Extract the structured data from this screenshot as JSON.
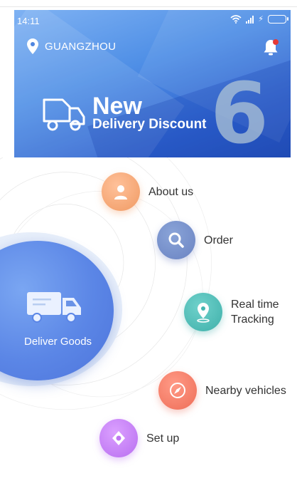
{
  "status_bar": {
    "time": "14:11"
  },
  "location": {
    "city": "GUANGZHOU"
  },
  "banner": {
    "title_line1": "New",
    "title_line2": "Delivery Discount",
    "number": "6"
  },
  "center": {
    "label": "Deliver Goods"
  },
  "menu": [
    {
      "label": "About us",
      "icon": "person-icon",
      "color": "#f3a06b"
    },
    {
      "label": "Order",
      "icon": "search-icon",
      "color": "#7189c8"
    },
    {
      "label_line1": "Real time",
      "label_line2": "Tracking",
      "icon": "location-pin-icon",
      "color": "#45b6b0"
    },
    {
      "label": "Nearby vehicles",
      "icon": "compass-icon",
      "color": "#ef735d"
    },
    {
      "label": "Set up",
      "icon": "settings-icon",
      "color": "#bf76f2"
    }
  ],
  "colors": {
    "banner_start": "#7fb2f3",
    "banner_end": "#2450b8",
    "core": "#5b86e6",
    "notification_dot": "#e53935"
  }
}
